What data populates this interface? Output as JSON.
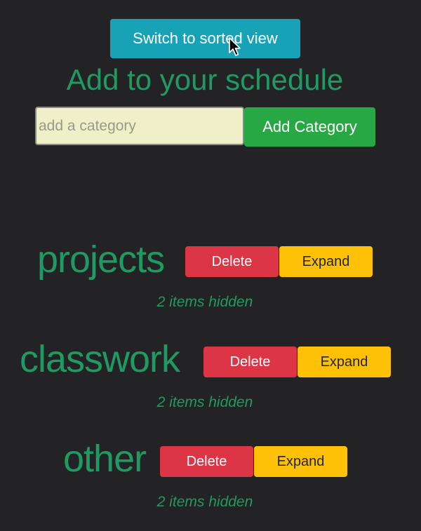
{
  "header": {
    "sort_button_label": "Switch to sorted view",
    "title": "Add to your schedule"
  },
  "add_form": {
    "placeholder": "add a category",
    "value": "",
    "button_label": "Add Category"
  },
  "categories": [
    {
      "name": "projects",
      "delete_label": "Delete",
      "expand_label": "Expand",
      "hidden_text": "2 items hidden"
    },
    {
      "name": "classwork",
      "delete_label": "Delete",
      "expand_label": "Expand",
      "hidden_text": "2 items hidden"
    },
    {
      "name": "other",
      "delete_label": "Delete",
      "expand_label": "Expand",
      "hidden_text": "2 items hidden"
    }
  ],
  "colors": {
    "background": "#232224",
    "accent_green": "#1f9a63",
    "info": "#17a2b8",
    "success": "#28a745",
    "danger": "#dc3545",
    "warning": "#ffc107"
  },
  "icons": {
    "cursor": "mouse-pointer-icon"
  }
}
